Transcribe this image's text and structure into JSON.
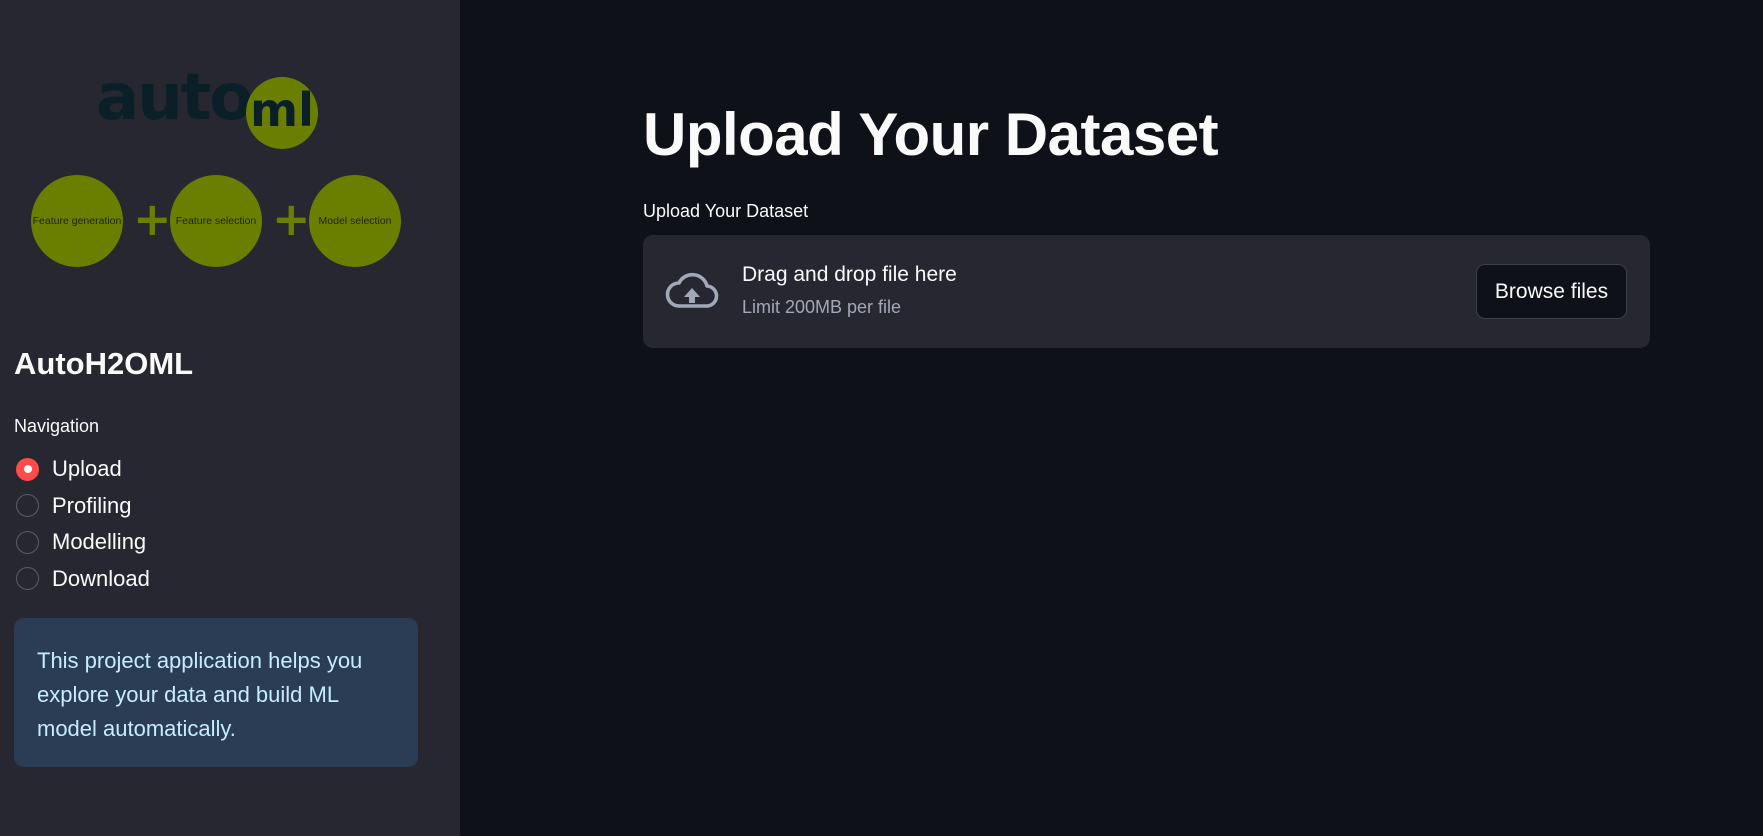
{
  "sidebar": {
    "logo": {
      "text_auto": "auto",
      "text_ml": "ml",
      "steps": [
        "Feature generation",
        "Feature selection",
        "Model selection"
      ],
      "plus": "+",
      "colors": {
        "circle": "#6a7f00",
        "text": "#0a1f27"
      }
    },
    "title": "AutoH2OML",
    "navigation": {
      "label": "Navigation",
      "options": [
        "Upload",
        "Profiling",
        "Modelling",
        "Download"
      ],
      "selected": "Upload"
    },
    "info": "This project application helps you explore your data and build ML model automatically."
  },
  "main": {
    "title": "Upload Your Dataset",
    "uploader": {
      "label": "Upload Your Dataset",
      "drop_text": "Drag and drop file here",
      "limit_text": "Limit 200MB per file",
      "button": "Browse files",
      "icon": "cloud-upload-icon"
    }
  },
  "colors": {
    "background": "#0e1117",
    "sidebar": "#262730",
    "accent": "#ff4b4b",
    "info_bg": "#2a3d55",
    "info_text": "#c7ebff"
  }
}
